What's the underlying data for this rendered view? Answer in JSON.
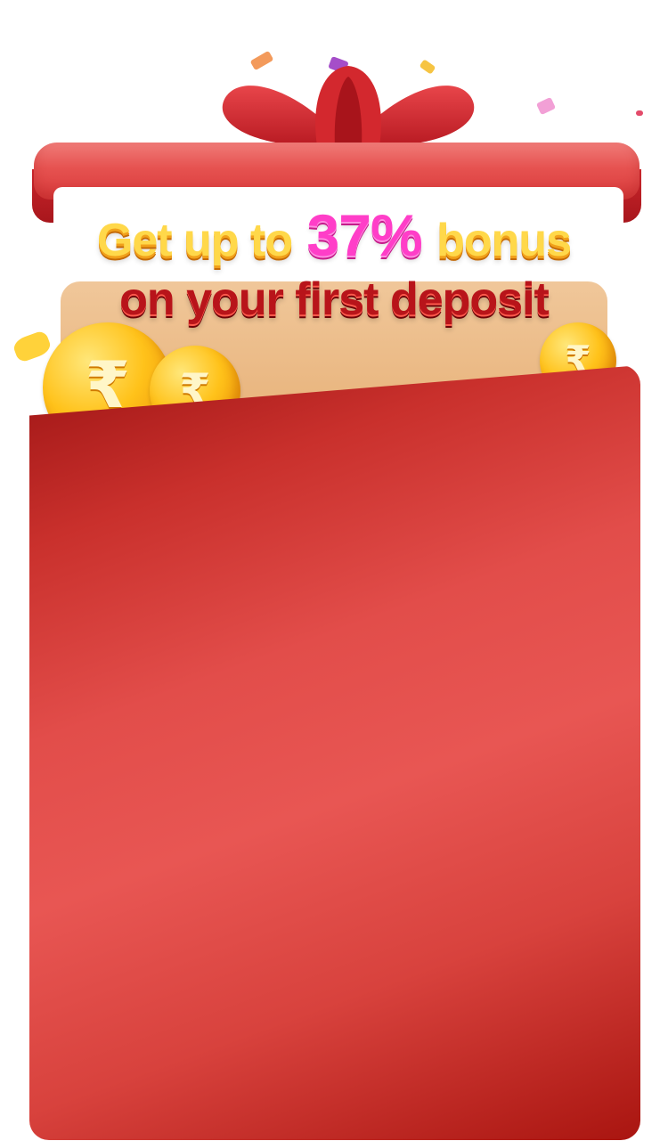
{
  "promo": {
    "headline_prefix": "Get up to",
    "headline_percent": "37%",
    "headline_suffix": "bonus",
    "subheadline": "on your first deposit"
  },
  "icons": {
    "coin": "rupee-coin-icon",
    "coin_glyph": "₹",
    "bow": "ribbon-bow-icon"
  },
  "colors": {
    "card_red": "#e24d4a",
    "dark_red": "#a91510",
    "gold": "#ffd84a",
    "pink": "#ff3ec8"
  }
}
